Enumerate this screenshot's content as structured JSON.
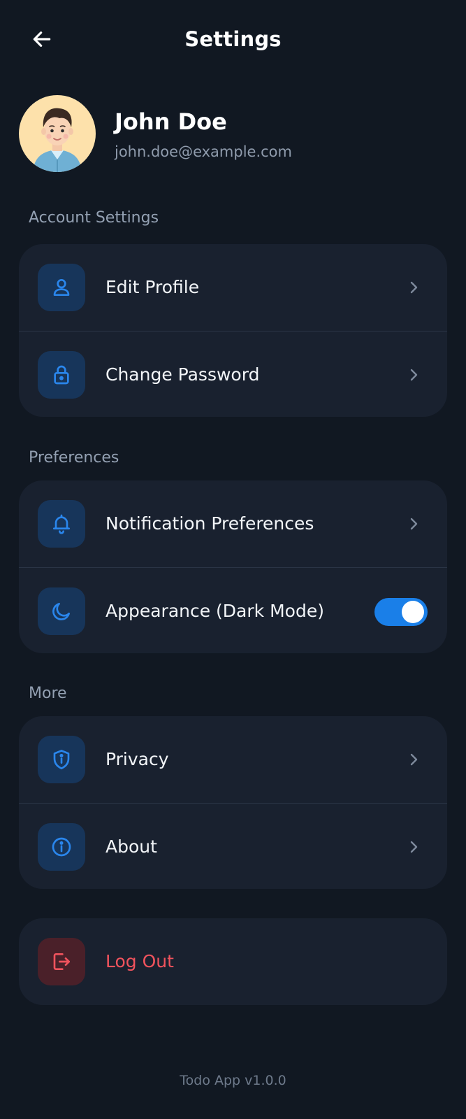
{
  "header": {
    "title": "Settings",
    "back_icon": "arrow-left-icon"
  },
  "profile": {
    "name": "John Doe",
    "email": "john.doe@example.com"
  },
  "sections": [
    {
      "label": "Account Settings",
      "items": [
        {
          "label": "Edit Profile",
          "icon": "user-icon",
          "action": "chevron"
        },
        {
          "label": "Change Password",
          "icon": "lock-icon",
          "action": "chevron"
        }
      ]
    },
    {
      "label": "Preferences",
      "items": [
        {
          "label": "Notification Preferences",
          "icon": "bell-icon",
          "action": "chevron"
        },
        {
          "label": "Appearance (Dark Mode)",
          "icon": "moon-icon",
          "action": "toggle",
          "toggle_on": true
        }
      ]
    },
    {
      "label": "More",
      "items": [
        {
          "label": "Privacy",
          "icon": "shield-info-icon",
          "action": "chevron"
        },
        {
          "label": "About",
          "icon": "info-icon",
          "action": "chevron"
        }
      ]
    }
  ],
  "logout": {
    "label": "Log Out",
    "icon": "logout-icon"
  },
  "footer": {
    "version": "Todo App v1.0.0"
  },
  "colors": {
    "background": "#111822",
    "card": "#19212f",
    "accent": "#1a7fe8",
    "icon_blue": "#2a86ec",
    "danger": "#f0535d",
    "muted_text": "#93a0b2"
  }
}
